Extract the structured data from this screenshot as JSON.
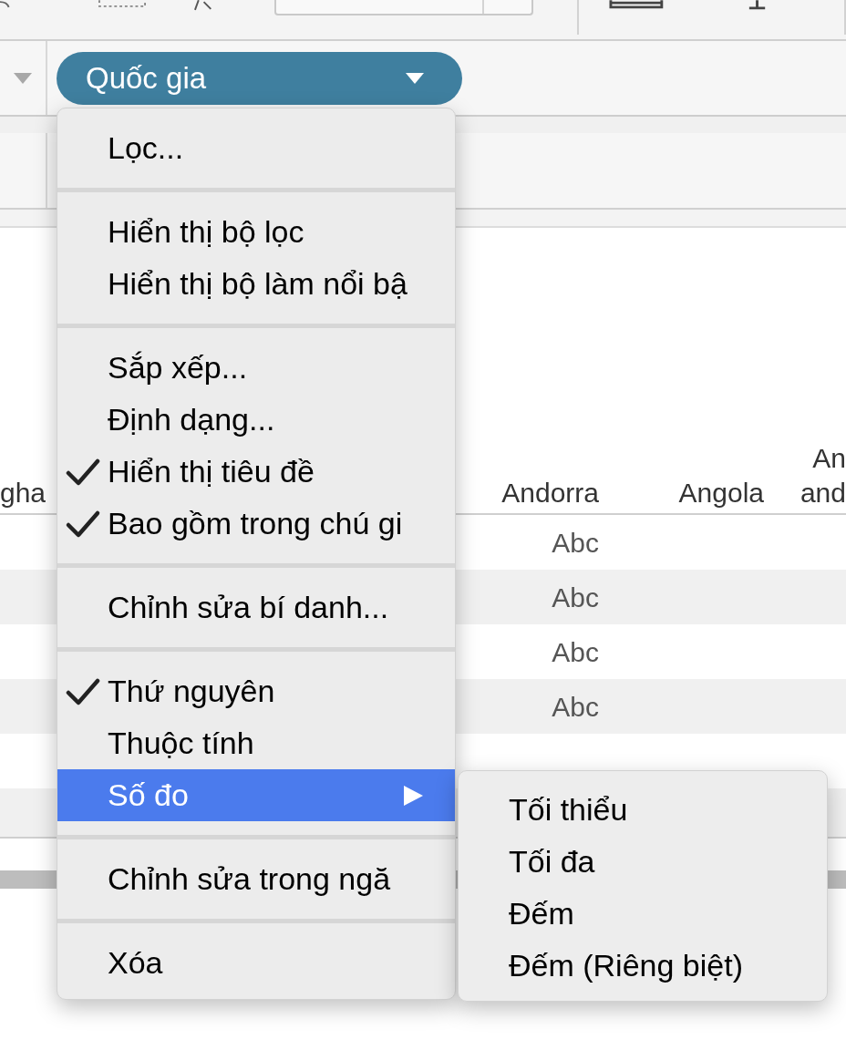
{
  "shelf": {
    "pill": {
      "label": "Quốc gia"
    }
  },
  "table": {
    "columns": [
      {
        "lines": [
          "gha"
        ]
      },
      {
        "lines": [
          "Andorra"
        ]
      },
      {
        "lines": [
          "Angola"
        ]
      },
      {
        "lines": [
          "An",
          "and"
        ]
      }
    ],
    "rows": [
      {
        "cells": [
          null,
          "Abc",
          null,
          null
        ]
      },
      {
        "cells": [
          null,
          "Abc",
          null,
          null
        ]
      },
      {
        "cells": [
          null,
          "Abc",
          null,
          null
        ]
      },
      {
        "cells": [
          null,
          "Abc",
          null,
          null
        ]
      }
    ]
  },
  "menu": {
    "items": [
      {
        "kind": "item",
        "label": "Lọc...",
        "checked": false,
        "selected": false
      },
      {
        "kind": "separator"
      },
      {
        "kind": "item",
        "label": "Hiển thị bộ lọc",
        "checked": false,
        "selected": false
      },
      {
        "kind": "item",
        "label": "Hiển thị bộ làm nổi bậ",
        "checked": false,
        "selected": false
      },
      {
        "kind": "separator"
      },
      {
        "kind": "item",
        "label": "Sắp xếp...",
        "checked": false,
        "selected": false
      },
      {
        "kind": "item",
        "label": "Định dạng...",
        "checked": false,
        "selected": false
      },
      {
        "kind": "item",
        "label": "Hiển thị tiêu đề",
        "checked": true,
        "selected": false
      },
      {
        "kind": "item",
        "label": "Bao gồm trong chú gi",
        "checked": true,
        "selected": false
      },
      {
        "kind": "separator"
      },
      {
        "kind": "item",
        "label": "Chỉnh sửa bí danh...",
        "checked": false,
        "selected": false
      },
      {
        "kind": "separator"
      },
      {
        "kind": "item",
        "label": "Thứ nguyên",
        "checked": true,
        "selected": false
      },
      {
        "kind": "item",
        "label": "Thuộc tính",
        "checked": false,
        "selected": false
      },
      {
        "kind": "submenu",
        "label": "Số đo",
        "checked": false,
        "selected": true
      },
      {
        "kind": "separator"
      },
      {
        "kind": "item",
        "label": "Chỉnh sửa trong ngă",
        "checked": false,
        "selected": false
      },
      {
        "kind": "separator"
      },
      {
        "kind": "item",
        "label": "Xóa",
        "checked": false,
        "selected": false
      }
    ]
  },
  "submenu": {
    "items": [
      {
        "label": "Tối thiểu",
        "selected": false
      },
      {
        "label": "Tối đa",
        "selected": false
      },
      {
        "label": "Đếm",
        "selected": false
      },
      {
        "label": "Đếm (Riêng biệt)",
        "selected": false
      }
    ]
  }
}
